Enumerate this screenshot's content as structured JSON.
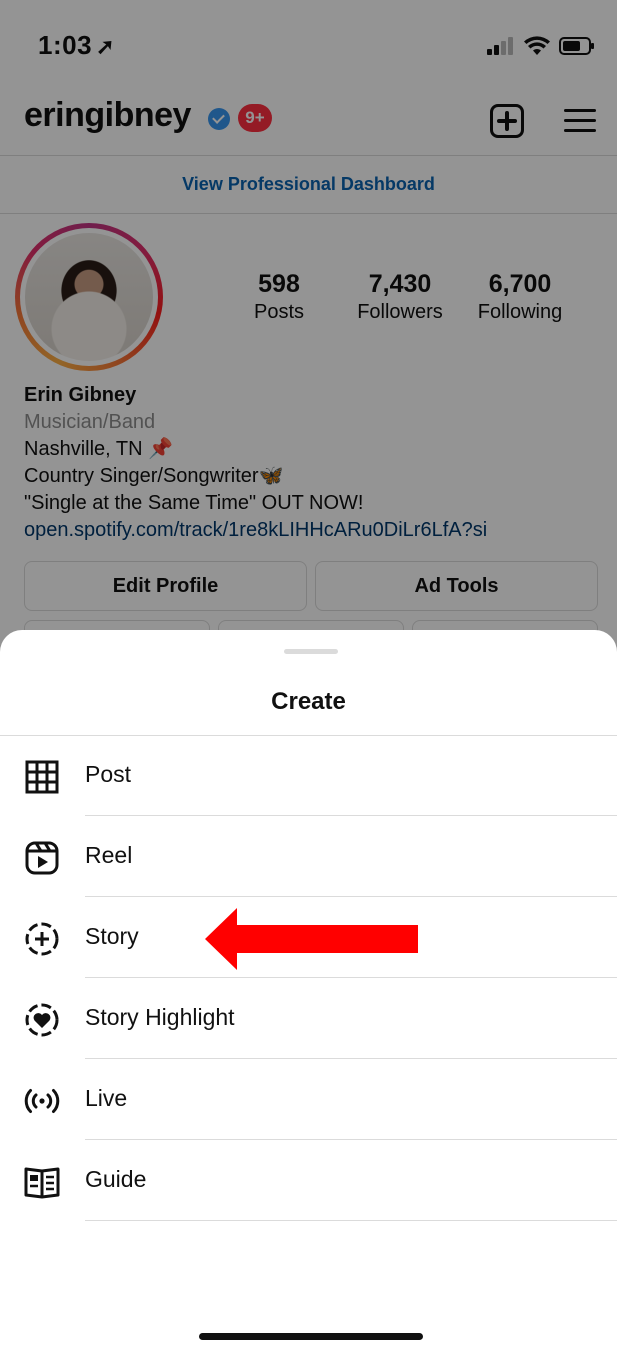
{
  "status_bar": {
    "time": "1:03"
  },
  "header": {
    "username": "eringibney",
    "notification_count": "9+"
  },
  "dashboard_link": "View Professional Dashboard",
  "stats": [
    {
      "value": "598",
      "label": "Posts"
    },
    {
      "value": "7,430",
      "label": "Followers"
    },
    {
      "value": "6,700",
      "label": "Following"
    }
  ],
  "bio": {
    "name": "Erin Gibney",
    "category": "Musician/Band",
    "line1": "Nashville, TN 📌",
    "line2": "Country Singer/Songwriter🦋",
    "line3": "\"Single at the Same Time\" OUT NOW!",
    "link": "open.spotify.com/track/1re8kLIHHcARu0DiLr6LfA?si"
  },
  "buttons": {
    "edit_profile": "Edit Profile",
    "ad_tools": "Ad Tools"
  },
  "sheet": {
    "title": "Create",
    "items": [
      {
        "label": "Post",
        "icon": "grid-icon"
      },
      {
        "label": "Reel",
        "icon": "reel-icon"
      },
      {
        "label": "Story",
        "icon": "story-add-icon"
      },
      {
        "label": "Story Highlight",
        "icon": "story-highlight-icon"
      },
      {
        "label": "Live",
        "icon": "live-icon"
      },
      {
        "label": "Guide",
        "icon": "guide-icon"
      }
    ]
  },
  "colors": {
    "accent_link": "#0a63b0",
    "badge": "#ff3040",
    "arrow": "#ff0000",
    "verified": "#3897f0"
  }
}
